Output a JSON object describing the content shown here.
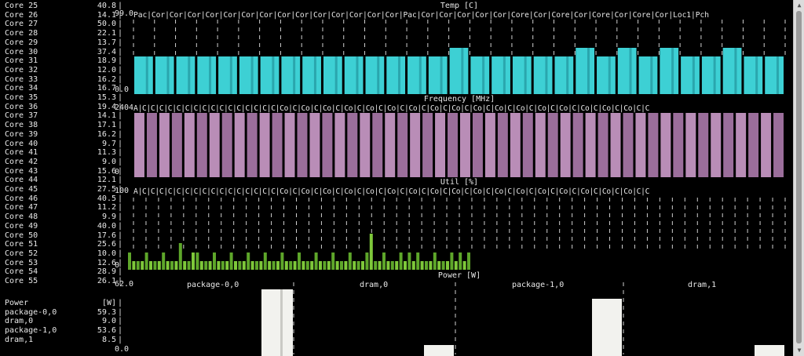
{
  "core_rows": [
    {
      "label": "Core 25",
      "value": "40.8"
    },
    {
      "label": "Core 26",
      "value": "14.1"
    },
    {
      "label": "Core 27",
      "value": "50.0"
    },
    {
      "label": "Core 28",
      "value": "22.1"
    },
    {
      "label": "Core 29",
      "value": "13.7"
    },
    {
      "label": "Core 30",
      "value": "37.4"
    },
    {
      "label": "Core 31",
      "value": "18.9"
    },
    {
      "label": "Core 32",
      "value": "12.0"
    },
    {
      "label": "Core 33",
      "value": "16.2"
    },
    {
      "label": "Core 34",
      "value": "16.7"
    },
    {
      "label": "Core 35",
      "value": "15.3"
    },
    {
      "label": "Core 36",
      "value": "19.4"
    },
    {
      "label": "Core 37",
      "value": "14.1"
    },
    {
      "label": "Core 38",
      "value": "17.1"
    },
    {
      "label": "Core 39",
      "value": "16.2"
    },
    {
      "label": "Core 40",
      "value": "9.7"
    },
    {
      "label": "Core 41",
      "value": "11.3"
    },
    {
      "label": "Core 42",
      "value": "9.0"
    },
    {
      "label": "Core 43",
      "value": "15.6"
    },
    {
      "label": "Core 44",
      "value": "12.1"
    },
    {
      "label": "Core 45",
      "value": "27.5"
    },
    {
      "label": "Core 46",
      "value": "40.5"
    },
    {
      "label": "Core 47",
      "value": "11.2"
    },
    {
      "label": "Core 48",
      "value": "9.9"
    },
    {
      "label": "Core 49",
      "value": "40.0"
    },
    {
      "label": "Core 50",
      "value": "17.6"
    },
    {
      "label": "Core 51",
      "value": "25.6"
    },
    {
      "label": "Core 52",
      "value": "10.0"
    },
    {
      "label": "Core 53",
      "value": "12.6"
    },
    {
      "label": "Core 54",
      "value": "28.9"
    },
    {
      "label": "Core 55",
      "value": "26.1"
    }
  ],
  "power_rows": [
    {
      "label": "Power",
      "value": "[W]"
    },
    {
      "label": "package-0,0",
      "value": "59.3"
    },
    {
      "label": "dram,0",
      "value": "9.0"
    },
    {
      "label": "package-1,0",
      "value": "53.6"
    },
    {
      "label": "dram,1",
      "value": "8.5"
    }
  ],
  "scales": {
    "temp_max": "99.0",
    "temp_min": "0.0",
    "freq_max": "2404",
    "freq_min": "0",
    "util_max": "100",
    "util_min": "0",
    "power_max": "62.0",
    "power_min": "0.0"
  },
  "titles": {
    "temp": "Temp [C]",
    "freq": "Frequency [MHz]",
    "util": "Util [%]",
    "power": "Power [W]"
  },
  "temp_header": "Pac|Cor|Cor|Cor|Cor|Cor|Cor|Cor|Cor|Cor|Cor|Cor|Cor|Cor|Cor|Pac|Cor|Cor|Cor|Cor|Cor|Core|Cor|Core|Cor|Core|Cor|Core|Cor|Loc1|Pch",
  "freq_header": "A|C|C|C|C|C|C|C|C|C|C|C|C|C|C|C|C|Co|C|Co|C|Co|C|Co|C|Co|C|Co|C|Co|C|Co|C|Co|C|Co|C|Co|C|Co|C|Co|C|Co|C|Co|C|Co|C|Co|C|C",
  "util_header": "A|C|C|C|C|C|C|C|C|C|C|C|C|C|C|C|C|Co|C|Co|C|Co|C|Co|C|Co|C|Co|C|Co|C|Co|C|Co|C|Co|C|Co|C|Co|C|Co|C|Co|C|Co|C|Co|C|Co|C|C",
  "power_labels": [
    "package-0,0",
    "dram,0",
    "package-1,0",
    "dram,1"
  ],
  "colors": {
    "temp": "#3dd0d4",
    "temp_alt": "#2aa6ad",
    "freq": "#9b6e9b",
    "freq_alt": "#b98db7",
    "util": "#7ec83a",
    "util_alt": "#5ea62a",
    "power": "#f2f2ee",
    "power_alt": "#c9c9c4"
  }
}
